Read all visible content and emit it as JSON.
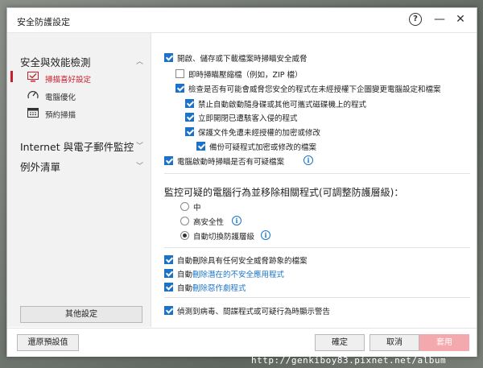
{
  "window": {
    "title": "安全防護設定",
    "help_glyph": "?",
    "minimize_glyph": "—",
    "close_glyph": "✕"
  },
  "sidebar": {
    "categories": [
      {
        "label": "安全與效能檢測",
        "expanded": true
      },
      {
        "label": "Internet 與電子郵件監控",
        "expanded": false
      },
      {
        "label": "例外清單",
        "expanded": false
      }
    ],
    "subitems": [
      {
        "label": "掃描喜好設定",
        "active": true,
        "icon": "monitor-check-icon"
      },
      {
        "label": "電腦優化",
        "active": false,
        "icon": "speedometer-icon"
      },
      {
        "label": "預約掃描",
        "active": false,
        "icon": "calendar-icon"
      }
    ],
    "other_settings_label": "其他設定"
  },
  "content": {
    "options": [
      {
        "label": "開啟、儲存或下載檔案時掃瞄安全威脅",
        "checked": true
      },
      {
        "label": "即時掃瞄壓縮檔（例如，ZIP 檔）",
        "checked": false
      },
      {
        "label": "檢查是否有可能會威脅您安全的程式在未經授權下企圖變更電腦設定和檔案",
        "checked": true
      },
      {
        "label": "禁止自動啟動隨身碟或其他可攜式磁碟機上的程式",
        "checked": true
      },
      {
        "label": "立即開閉已遭駭客入侵的程式",
        "checked": true
      },
      {
        "label": "保護文件免遭未經授權的加密或修改",
        "checked": true
      },
      {
        "label": "備份可疑程式加密或修改的檔案",
        "checked": true
      },
      {
        "label": "電腦啟動時掃瞄是否有可疑檔案",
        "checked": true
      }
    ],
    "heading": "監控可疑的電腦行為並移除相關程式(可調整防護層級)：",
    "radios": [
      {
        "label": "中",
        "selected": false
      },
      {
        "label": "高安全性",
        "selected": false
      },
      {
        "label": "自動切換防護層級",
        "selected": true
      }
    ],
    "options2": [
      {
        "label": "自動刪除具有任何安全威脅跡象的檔案",
        "checked": true
      },
      {
        "prefix": "自動",
        "link": "刪除潛在的不安全應用程式",
        "checked": true
      },
      {
        "prefix": "自動",
        "link": "刪除惡作劇程式",
        "checked": true
      }
    ],
    "options3": [
      {
        "label": "偵測到病毒、間諜程式或可疑行為時顯示警告",
        "checked": true
      }
    ],
    "info_glyph": "i"
  },
  "footer": {
    "reset_label": "還原預設值",
    "ok_label": "確定",
    "cancel_label": "取消",
    "apply_label": "套用"
  },
  "watermark": "http://genkiboy83.pixnet.net/album",
  "colors": {
    "accent_red": "#c8202e",
    "checkbox_blue": "#1a73c9",
    "apply_disabled": "#f4a9ae"
  }
}
